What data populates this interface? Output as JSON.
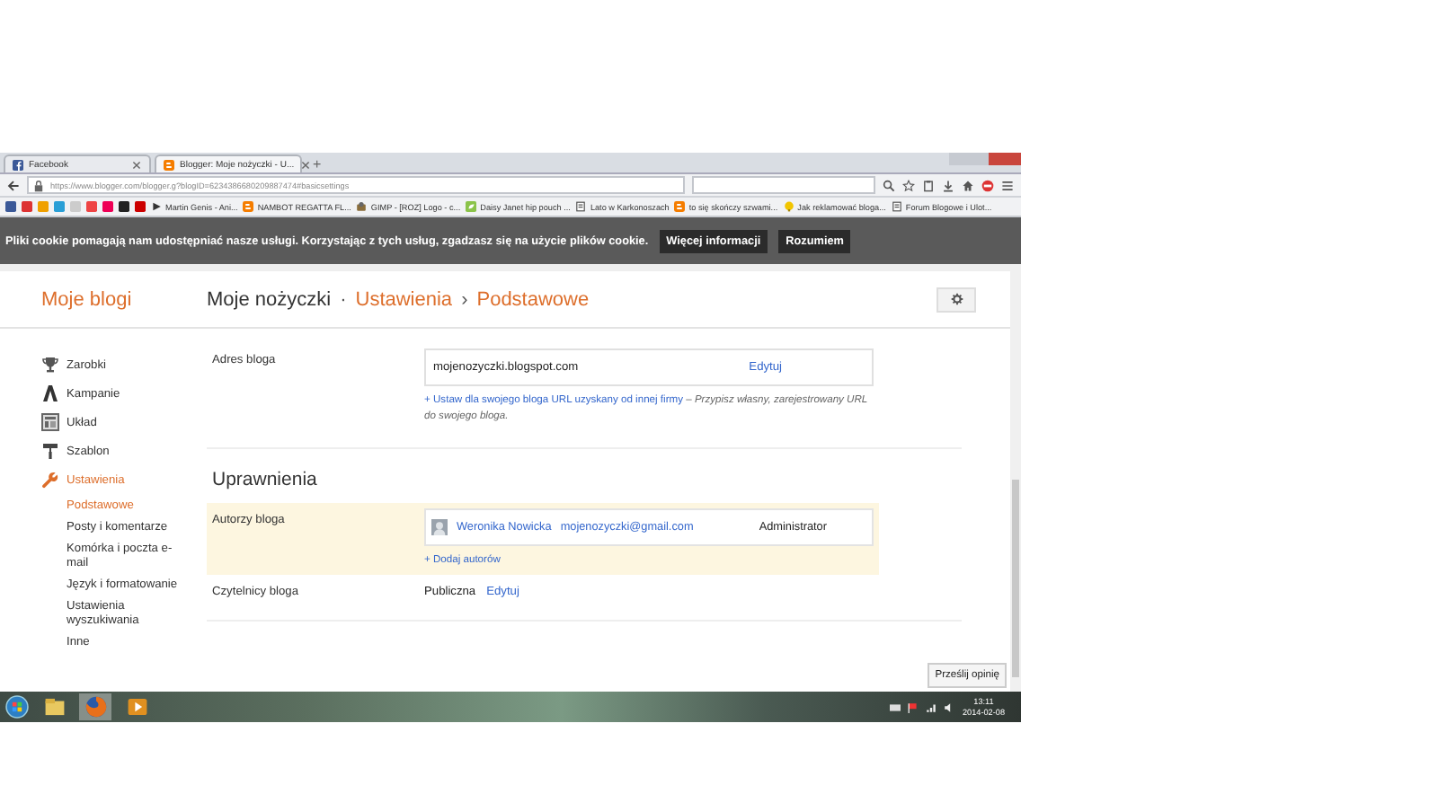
{
  "browser": {
    "tabs": [
      {
        "label": "Facebook",
        "kind": "facebook",
        "selected": false
      },
      {
        "label": "Blogger: Moje nożyczki - U...",
        "kind": "blogger",
        "selected": true
      }
    ],
    "new_tab": "+",
    "url": "https://www.blogger.com/blogger.g?blogID=6234386680209887474#basicsettings",
    "bookmarks": [
      {
        "label": "Martin Genis - Ani...",
        "kind": "play"
      },
      {
        "label": "NAMBOT REGATTA FL...",
        "kind": "blogger"
      },
      {
        "label": "GIMP - [ROZ] Logo - c...",
        "kind": "gimp"
      },
      {
        "label": "Daisy Janet hip pouch ...",
        "kind": "leaf"
      },
      {
        "label": "Lato w Karkonoszach",
        "kind": "page"
      },
      {
        "label": "to się skończy szwami...",
        "kind": "blogger"
      },
      {
        "label": "Jak reklamować bloga...",
        "kind": "bulb"
      },
      {
        "label": "Forum Blogowe i Ulot...",
        "kind": "page"
      }
    ]
  },
  "cookie_bar": {
    "text": "Pliki cookie pomagają nam udostępniać nasze usługi. Korzystając z tych usług, zgadzasz się na użycie plików cookie.",
    "buttons": [
      "Więcej informacji",
      "Rozumiem"
    ]
  },
  "header": {
    "title": "Moje blogi",
    "blog_name": "Moje nożyczki",
    "separator_1": "·",
    "section": "Ustawienia",
    "separator_2": "›",
    "page": "Podstawowe"
  },
  "sidebar": {
    "items": [
      {
        "label": "Zarobki",
        "kind": "trophy",
        "selected": false
      },
      {
        "label": "Kampanie",
        "kind": "campaign",
        "selected": false
      },
      {
        "label": "Układ",
        "kind": "layout",
        "selected": false
      },
      {
        "label": "Szablon",
        "kind": "roller",
        "selected": false
      },
      {
        "label": "Ustawienia",
        "kind": "wrench",
        "selected": true,
        "children": [
          {
            "label": "Podstawowe",
            "selected": true
          },
          {
            "label": "Posty i komentarze",
            "selected": false
          },
          {
            "label": "Komórka i poczta e-mail",
            "selected": false
          },
          {
            "label": "Język i formatowanie",
            "selected": false
          },
          {
            "label": "Ustawienia wyszukiwania",
            "selected": false
          },
          {
            "label": "Inne",
            "selected": false
          }
        ]
      }
    ]
  },
  "address": {
    "label": "Adres bloga",
    "value": "mojenozyczki.blogspot.com",
    "edit": "Edytuj",
    "link": "+ Ustaw dla swojego bloga URL uzyskany od innej firmy",
    "hint": " – *Przypisz własny, zarejestrowany URL do swojego bloga.*"
  },
  "permissions": {
    "title": "Uprawnienia",
    "authors_label": "Autorzy bloga",
    "authors": [
      {
        "name": "Weronika Nowicka",
        "email": "mojenozyczki@gmail.com",
        "role": "Administrator"
      }
    ],
    "add_author": "+ Dodaj autorów",
    "readers_label": "Czytelnicy bloga",
    "readers_value": "Publiczna",
    "readers_edit": "Edytuj"
  },
  "feedback_button": "Prześlij opinię",
  "taskbar": {
    "time": "13:11",
    "date": "2014-02-08"
  }
}
